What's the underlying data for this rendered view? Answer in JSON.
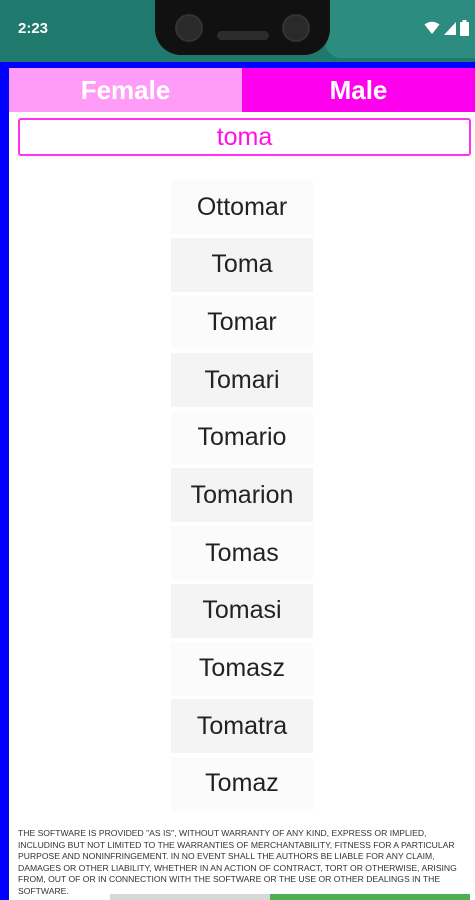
{
  "status_bar": {
    "time": "2:23",
    "icons": [
      "wifi-icon",
      "signal-icon",
      "battery-icon"
    ]
  },
  "tabs": [
    {
      "label": "Female",
      "selected": false
    },
    {
      "label": "Male",
      "selected": true
    }
  ],
  "search": {
    "value": "toma"
  },
  "results": [
    "Ottomar",
    "Toma",
    "Tomar",
    "Tomari",
    "Tomario",
    "Tomarion",
    "Tomas",
    "Tomasi",
    "Tomasz",
    "Tomatra",
    "Tomaz"
  ],
  "license_text": "THE SOFTWARE IS PROVIDED \"AS IS\", WITHOUT WARRANTY OF ANY KIND, EXPRESS OR IMPLIED, INCLUDING BUT NOT LIMITED TO THE WARRANTIES OF MERCHANTABILITY, FITNESS FOR A PARTICULAR PURPOSE AND NONINFRINGEMENT. IN NO EVENT SHALL THE AUTHORS BE LIABLE FOR ANY CLAIM, DAMAGES OR OTHER LIABILITY, WHETHER IN AN ACTION OF CONTRACT, TORT OR OTHERWISE, ARISING FROM, OUT OF OR IN CONNECTION WITH THE SOFTWARE OR THE USE OR OTHER DEALINGS IN THE SOFTWARE.",
  "colors": {
    "female_tab": "#ff9cf8",
    "male_tab": "#ff00ef",
    "accent": "#ff10e8",
    "frame": "#0000ff",
    "status_bar": "#1f7a6d"
  }
}
